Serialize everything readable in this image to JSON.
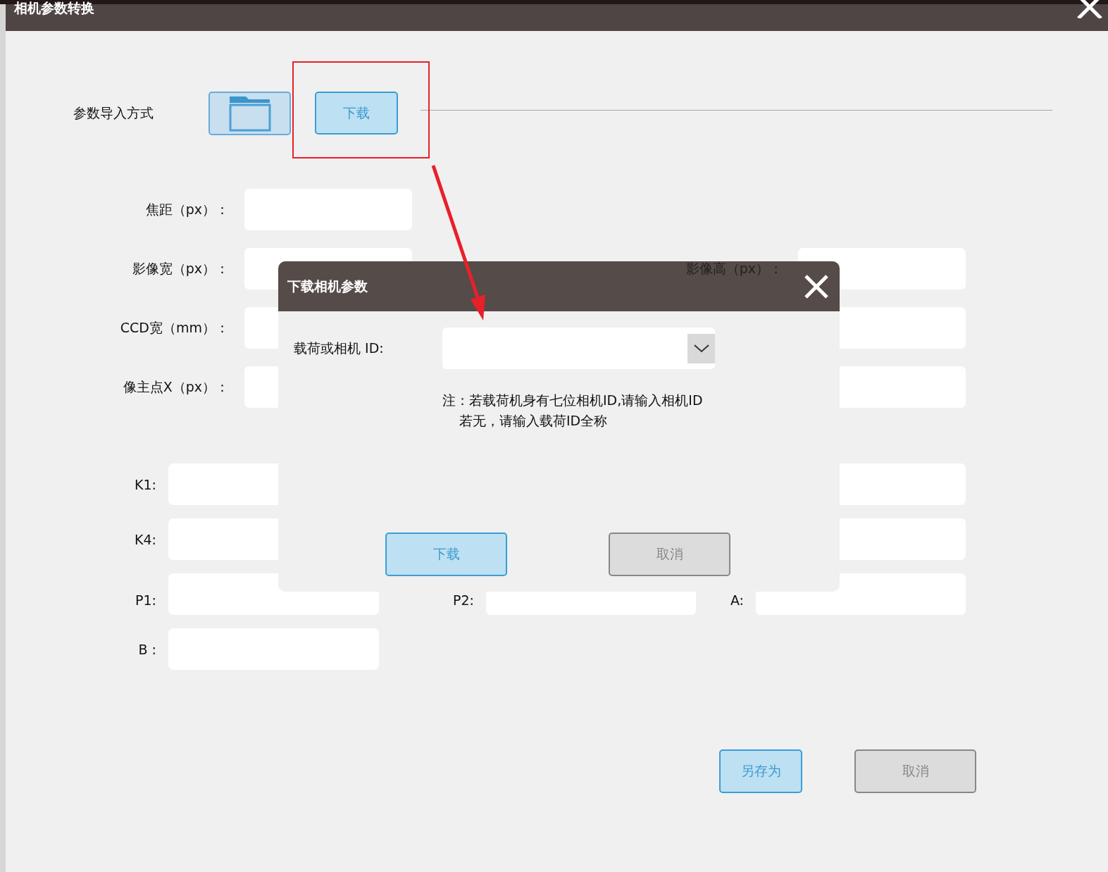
{
  "window": {
    "title": "相机参数转换"
  },
  "import": {
    "label": "参数导入方式",
    "buttons": [
      {
        "kind": "folder"
      },
      {
        "kind": "text",
        "label": "下载",
        "highlighted": true
      }
    ]
  },
  "param_rows": [
    {
      "kind": "wide",
      "cells": [
        {
          "kind": "left",
          "label": "焦距（px）："
        }
      ]
    },
    {
      "kind": "wide",
      "cells": [
        {
          "kind": "left",
          "label": "影像宽（px）："
        },
        {
          "kind": "right",
          "label": "影像高（px）："
        }
      ]
    },
    {
      "kind": "wide",
      "cells": [
        {
          "kind": "left",
          "label": "CCD宽（mm）："
        },
        {
          "kind": "right"
        }
      ]
    },
    {
      "kind": "wide",
      "cells": [
        {
          "kind": "left",
          "label": "像主点X（px）："
        },
        {
          "kind": "right"
        }
      ]
    },
    {
      "kind": "narrow",
      "cells": [
        {
          "kind": "left",
          "label": "K1:"
        },
        {
          "kind": "right"
        }
      ]
    },
    {
      "kind": "narrow",
      "cells": [
        {
          "kind": "left",
          "label": "K4:"
        },
        {
          "kind": "right"
        }
      ]
    },
    {
      "kind": "narrow",
      "cells": [
        {
          "kind": "left",
          "label": "P1:"
        },
        {
          "kind": "middle",
          "label": "P2:"
        },
        {
          "kind": "right",
          "label": "A:"
        }
      ]
    },
    {
      "kind": "narrow",
      "cells": [
        {
          "kind": "left",
          "label": "B :"
        }
      ]
    }
  ],
  "footer_buttons": [
    {
      "kind": "primary",
      "label": "另存为"
    },
    {
      "kind": "secondary",
      "label": "取消"
    }
  ],
  "annotations": [
    {
      "kind": "arrow"
    }
  ],
  "dialog": {
    "title": "下载相机参数",
    "field_label": "载荷或相机 ID:",
    "note_lines": [
      "注：若载荷机身有七位相机ID,请输入相机ID",
      "若无，请输入载荷ID全称"
    ],
    "buttons": [
      {
        "kind": "primary",
        "label": "下载"
      },
      {
        "kind": "secondary",
        "label": "取消"
      }
    ]
  }
}
